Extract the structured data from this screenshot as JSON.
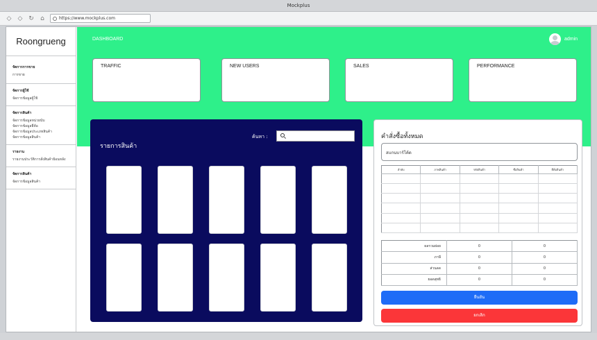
{
  "browser": {
    "window_title": "Mockplus",
    "url": "https://www.mockplus.com"
  },
  "sidebar": {
    "brand": "Roongrueng",
    "groups": [
      {
        "heading": "จัดการการขาย",
        "items": [
          "การขาย"
        ]
      },
      {
        "heading": "จัดการผู้ใช้",
        "items": [
          "จัดการข้อมูลผู้ใช้"
        ]
      },
      {
        "heading": "จัดการสินค้า",
        "items": [
          "จัดการข้อมูลหน่วยนับ",
          "จัดการข้อมูลยี่ห้อ",
          "จัดการข้อมูลประเภทสินค้า",
          "จัดการข้อมูลสินค้า"
        ]
      },
      {
        "heading": "รายงาน",
        "items": [
          "รายงานประวัติการสั่งสินค้าย้อนหลัง"
        ]
      },
      {
        "heading": "จัดการสินค้า",
        "items": [
          "จัดการข้อมูลสินค้า"
        ]
      }
    ]
  },
  "header": {
    "title": "DASHBOARD",
    "user": "admin",
    "accent_color": "#2ef08a"
  },
  "cards": [
    {
      "label": "TRAFFIC"
    },
    {
      "label": "NEW USERS"
    },
    {
      "label": "SALES"
    },
    {
      "label": "PERFORMANCE"
    }
  ],
  "products": {
    "title": "รายการสินค้า",
    "search_label": "ค้นหา :",
    "search_value": "",
    "panel_color": "#0a0b5e",
    "item_count": 10
  },
  "orders": {
    "title": "คำสั่งซื้อทั้งหมด",
    "member_placeholder": "สแกนบาร์โค้ด",
    "columns": [
      "ลำดับ",
      "ภาพสินค้า",
      "รหัสสินค้า",
      "ชื่อสินค้า",
      "ยี่ห้อสินค้า"
    ],
    "summary": [
      {
        "label": "ผลรวมย่อย",
        "value1": "0",
        "value2": "0"
      },
      {
        "label": "ภาษี",
        "value1": "0",
        "value2": "0"
      },
      {
        "label": "ส่วนลด",
        "value1": "0",
        "value2": "0"
      },
      {
        "label": "ยอดสุทธิ",
        "value1": "0",
        "value2": "0"
      }
    ],
    "confirm_label": "ยืนยัน",
    "cancel_label": "ยกเลิก",
    "confirm_color": "#1e6cf7",
    "cancel_color": "#fb3639"
  }
}
